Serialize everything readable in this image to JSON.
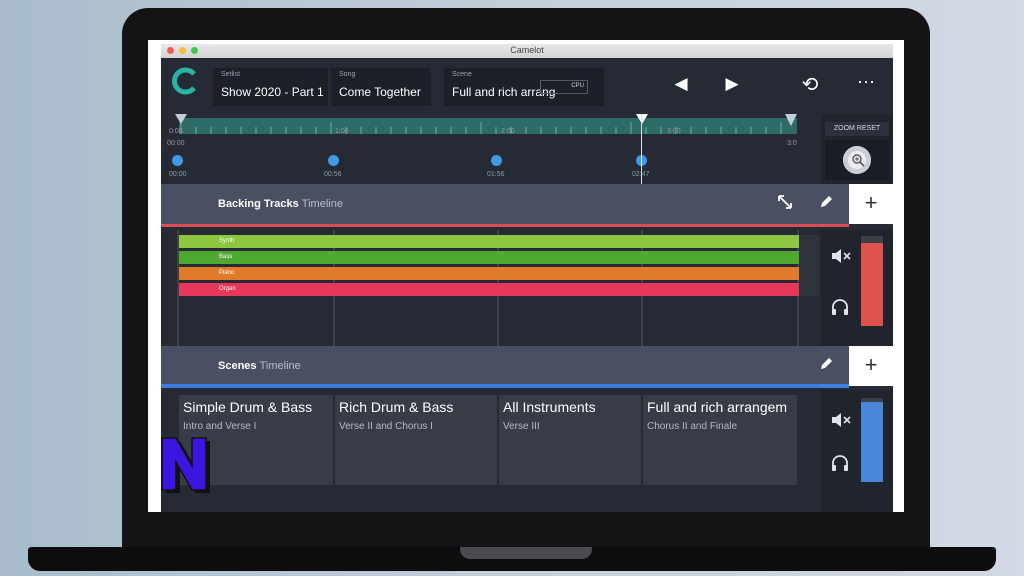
{
  "window": {
    "title": "Camelot"
  },
  "colors": {
    "accent": "#2bb3a3",
    "track_synth": "#8dc63f",
    "track_bass": "#4fa82f",
    "track_piano": "#e07b2a",
    "track_organ": "#e8375a",
    "backing_level": "#e0524c",
    "scenes_level": "#4a86d8",
    "backing_divider": "#d94d57",
    "scenes_divider": "#3d7ee0"
  },
  "header": {
    "logo_icon": "camelot-c-logo",
    "setlist": {
      "label": "Setlist",
      "value": "Show 2020 - Part 1"
    },
    "song": {
      "label": "Song",
      "value": "Come Together"
    },
    "scene": {
      "label": "Scene",
      "value": "Full and rich arrang",
      "cpu_label": "CPU"
    },
    "buttons": {
      "prev_icon": "◀",
      "next_icon": "▶",
      "history_icon": "⟲",
      "more_icon": "⋯"
    }
  },
  "ruler": {
    "ticks": [
      "0:00",
      "1:00",
      "2:00",
      "3:00",
      "3:0"
    ],
    "start_time": "00:00",
    "markers": [
      "00:00",
      "00:56",
      "01:56",
      "02:47"
    ]
  },
  "zoom": {
    "reset_label": "ZOOM RESET"
  },
  "backing_tracks": {
    "title": "Backing Tracks",
    "subtitle": "Timeline",
    "tracks": [
      {
        "name": "Synth"
      },
      {
        "name": "Bass"
      },
      {
        "name": "Piano"
      },
      {
        "name": "Organ"
      }
    ],
    "level": 0.92
  },
  "scenes": {
    "title": "Scenes",
    "subtitle": "Timeline",
    "items": [
      {
        "name": "Simple Drum & Bass",
        "sections": "Intro and Verse I"
      },
      {
        "name": "Rich Drum & Bass",
        "sections": "Verse II and Chorus I"
      },
      {
        "name": "All Instruments",
        "sections": "Verse III"
      },
      {
        "name": "Full and rich arrangem",
        "sections": "Chorus II and Finale"
      }
    ],
    "level": 0.95
  }
}
